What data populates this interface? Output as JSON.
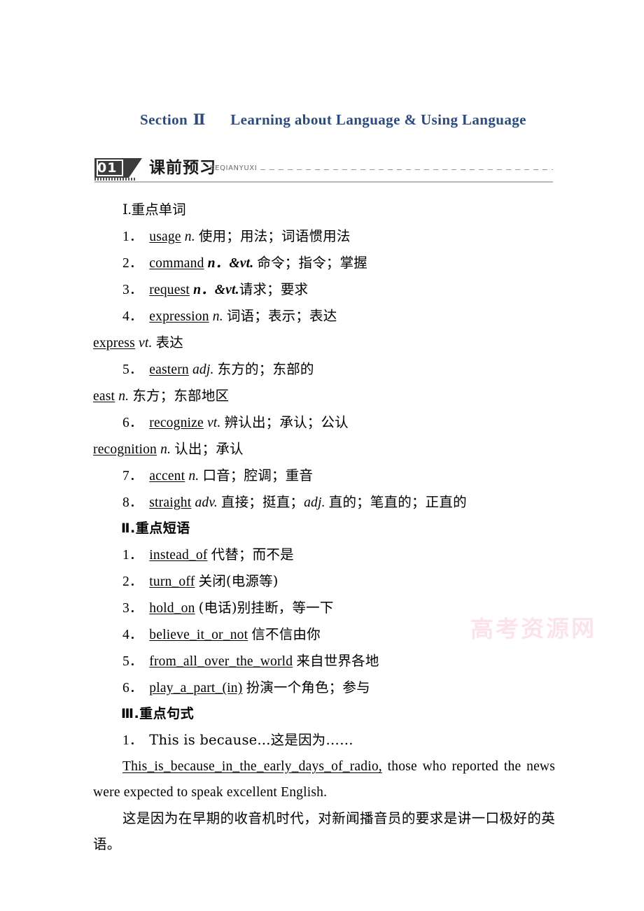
{
  "watermark": "高考资源网",
  "section": {
    "label": "Section",
    "numeral": "Ⅱ",
    "title": "Learning about Language & Using Language",
    "color": "#2b4a7d"
  },
  "banner": {
    "number": "01",
    "cn_title": "课前预习",
    "pinyin": "KEQIANYUXI"
  },
  "part1": {
    "heading": "Ⅰ.重点单词",
    "items": [
      {
        "num": "1．",
        "word": "usage",
        "pos": "n.",
        "def": "使用；用法；词语惯用法"
      },
      {
        "num": "2．",
        "word": "command",
        "pos": "n．&vt.",
        "def": "命令；指令；掌握"
      },
      {
        "num": "3．",
        "word": "request",
        "pos": "n．&vt.",
        "def": "请求；要求"
      },
      {
        "num": "4．",
        "word": "expression",
        "pos": "n.",
        "def": "词语；表示；表达"
      },
      {
        "num": "",
        "word": "express",
        "pos": "vt.",
        "def": "表达"
      },
      {
        "num": "5．",
        "word": "eastern",
        "pos": "adj.",
        "def": "东方的；东部的"
      },
      {
        "num": "",
        "word": "east",
        "pos": "n.",
        "def": "东方；东部地区"
      },
      {
        "num": "6．",
        "word": "recognize",
        "pos": "vt.",
        "def": "辨认出；承认；公认"
      },
      {
        "num": "",
        "word": "recognition",
        "pos": "n.",
        "def": "认出；承认"
      },
      {
        "num": "7．",
        "word": "accent",
        "pos": "n.",
        "def": "口音；腔调；重音"
      },
      {
        "num": "8．",
        "word": "straight",
        "pos": "adv.",
        "def": "直接；挺直；",
        "pos2": "adj.",
        "def2": "直的；笔直的；正直的"
      }
    ]
  },
  "part2": {
    "heading": "Ⅱ.重点短语",
    "items": [
      {
        "num": "1．",
        "phrase": "instead_of",
        "def": "代替；而不是"
      },
      {
        "num": "2．",
        "phrase": "turn_off",
        "def": "关闭(电源等)"
      },
      {
        "num": "3．",
        "phrase": "hold_on",
        "def": "(电话)别挂断，等一下"
      },
      {
        "num": "4．",
        "phrase": "believe_it_or_not",
        "def": "信不信由你"
      },
      {
        "num": "5．",
        "phrase": "from_all_over_the_world",
        "def": "来自世界各地"
      },
      {
        "num": "6．",
        "phrase": "play_a_part_(in)",
        "def": "扮演一个角色；参与"
      }
    ]
  },
  "part3": {
    "heading": "Ⅲ.重点句式",
    "item_num": "1．",
    "pattern": "This is because...这是因为……",
    "example_underlined": "This_is_because_in_the_early_days_of_radio,",
    "example_rest": " those who reported the news were expected to speak excellent English.",
    "translation": "这是因为在早期的收音机时代，对新闻播音员的要求是讲一口极好的英语。"
  }
}
